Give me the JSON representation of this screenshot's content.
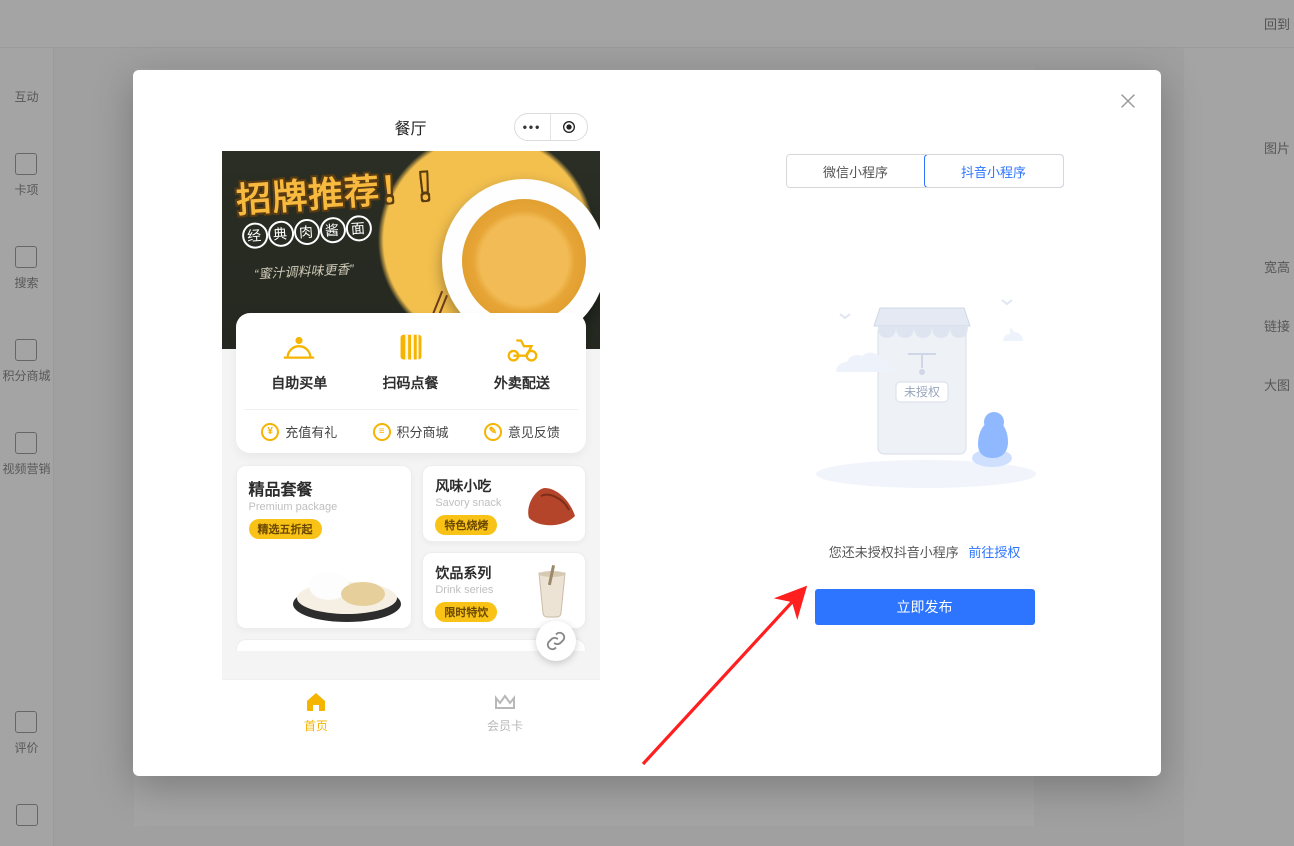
{
  "bg": {
    "back": "回到",
    "sidebar": {
      "interactive": "互动",
      "cards": "卡项",
      "search": "搜索",
      "mall": "积分商城",
      "video": "视频营销",
      "reviews": "评价"
    },
    "rightcol": {
      "image": "图片",
      "size": "宽高",
      "link": "链接",
      "bigimg": "大图"
    }
  },
  "modal": {
    "platforms": {
      "wechat": "微信小程序",
      "douyin": "抖音小程序"
    },
    "empty": {
      "badge": "未授权",
      "hint": "您还未授权抖音小程序",
      "link": "前往授权"
    },
    "publish": "立即发布"
  },
  "phone": {
    "title": "餐厅",
    "banner": {
      "headline": "招牌推荐！！",
      "badge_chars": [
        "经",
        "典",
        "肉",
        "酱",
        "面"
      ],
      "sub": "“蜜汁调料味更香”"
    },
    "features": {
      "main": [
        {
          "label": "自助买单"
        },
        {
          "label": "扫码点餐"
        },
        {
          "label": "外卖配送"
        }
      ],
      "sub": [
        {
          "label": "充值有礼",
          "glyph": "¥"
        },
        {
          "label": "积分商城",
          "glyph": "≡"
        },
        {
          "label": "意见反馈",
          "glyph": "✎"
        }
      ]
    },
    "promos": {
      "big": {
        "title": "精品套餐",
        "en": "Premium package",
        "tag": "精选五折起"
      },
      "small": [
        {
          "title": "风味小吃",
          "en": "Savory snack",
          "tag": "特色烧烤"
        },
        {
          "title": "饮品系列",
          "en": "Drink series",
          "tag": "限时特饮"
        }
      ]
    },
    "tabs": {
      "home": "首页",
      "member": "会员卡"
    }
  }
}
